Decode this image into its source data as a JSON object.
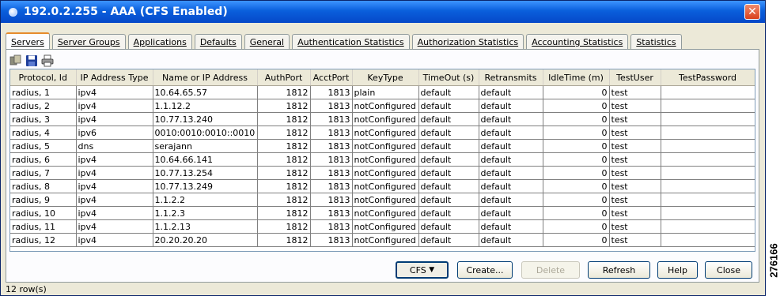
{
  "window": {
    "title": "192.0.2.255 - AAA (CFS Enabled)",
    "close_glyph": "✕"
  },
  "tabs": [
    {
      "label": "Servers",
      "active": true
    },
    {
      "label": "Server Groups",
      "active": false
    },
    {
      "label": "Applications",
      "active": false
    },
    {
      "label": "Defaults",
      "active": false
    },
    {
      "label": "General",
      "active": false
    },
    {
      "label": "Authentication Statistics",
      "active": false
    },
    {
      "label": "Authorization Statistics",
      "active": false
    },
    {
      "label": "Accounting Statistics",
      "active": false
    },
    {
      "label": "Statistics",
      "active": false
    }
  ],
  "toolbar": {
    "icons": [
      "copy-icon",
      "save-icon",
      "print-icon"
    ]
  },
  "table": {
    "columns": [
      "Protocol, Id",
      "IP Address Type",
      "Name or IP Address",
      "AuthPort",
      "AcctPort",
      "KeyType",
      "TimeOut (s)",
      "Retransmits",
      "IdleTime (m)",
      "TestUser",
      "TestPassword"
    ],
    "rows": [
      [
        "radius, 1",
        "ipv4",
        "10.64.65.57",
        "1812",
        "1813",
        "plain",
        "default",
        "default",
        "0",
        "test",
        ""
      ],
      [
        "radius, 2",
        "ipv4",
        "1.1.12.2",
        "1812",
        "1813",
        "notConfigured",
        "default",
        "default",
        "0",
        "test",
        ""
      ],
      [
        "radius, 3",
        "ipv4",
        "10.77.13.240",
        "1812",
        "1813",
        "notConfigured",
        "default",
        "default",
        "0",
        "test",
        ""
      ],
      [
        "radius, 4",
        "ipv6",
        "0010:0010:0010::0010",
        "1812",
        "1813",
        "notConfigured",
        "default",
        "default",
        "0",
        "test",
        ""
      ],
      [
        "radius, 5",
        "dns",
        "serajann",
        "1812",
        "1813",
        "notConfigured",
        "default",
        "default",
        "0",
        "test",
        ""
      ],
      [
        "radius, 6",
        "ipv4",
        "10.64.66.141",
        "1812",
        "1813",
        "notConfigured",
        "default",
        "default",
        "0",
        "test",
        ""
      ],
      [
        "radius, 7",
        "ipv4",
        "10.77.13.254",
        "1812",
        "1813",
        "notConfigured",
        "default",
        "default",
        "0",
        "test",
        ""
      ],
      [
        "radius, 8",
        "ipv4",
        "10.77.13.249",
        "1812",
        "1813",
        "notConfigured",
        "default",
        "default",
        "0",
        "test",
        ""
      ],
      [
        "radius, 9",
        "ipv4",
        "1.1.2.2",
        "1812",
        "1813",
        "notConfigured",
        "default",
        "default",
        "0",
        "test",
        ""
      ],
      [
        "radius, 10",
        "ipv4",
        "1.1.2.3",
        "1812",
        "1813",
        "notConfigured",
        "default",
        "default",
        "0",
        "test",
        ""
      ],
      [
        "radius, 11",
        "ipv4",
        "1.1.2.13",
        "1812",
        "1813",
        "notConfigured",
        "default",
        "default",
        "0",
        "test",
        ""
      ],
      [
        "radius, 12",
        "ipv4",
        "20.20.20.20",
        "1812",
        "1813",
        "notConfigured",
        "default",
        "default",
        "0",
        "test",
        ""
      ]
    ]
  },
  "buttons": {
    "cfs": "CFS",
    "cfs_arrow": "▼",
    "create": "Create...",
    "delete": "Delete",
    "refresh": "Refresh",
    "help": "Help",
    "close": "Close"
  },
  "status": {
    "row_count": "12 row(s)"
  },
  "figure_id": "276166",
  "colors": {
    "titlebar": "#0a5fdc",
    "close": "#d9411c",
    "active_tab_accent": "#e68b2c"
  }
}
